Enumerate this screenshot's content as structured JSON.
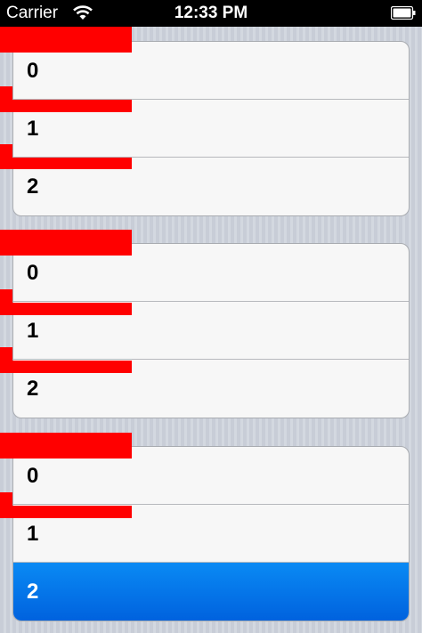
{
  "status_bar": {
    "carrier": "Carrier",
    "time": "12:33 PM",
    "wifi_icon": "wifi-icon",
    "battery_icon": "battery-icon"
  },
  "sections": [
    {
      "rows": [
        {
          "label": "0"
        },
        {
          "label": "1"
        },
        {
          "label": "2"
        }
      ]
    },
    {
      "rows": [
        {
          "label": "0"
        },
        {
          "label": "1"
        },
        {
          "label": "2"
        }
      ]
    },
    {
      "rows": [
        {
          "label": "0"
        },
        {
          "label": "1"
        },
        {
          "label": "2",
          "selected": true
        }
      ]
    }
  ],
  "colors": {
    "overlay_red": "#ff0000",
    "selection_blue": "#0a7ef0"
  }
}
